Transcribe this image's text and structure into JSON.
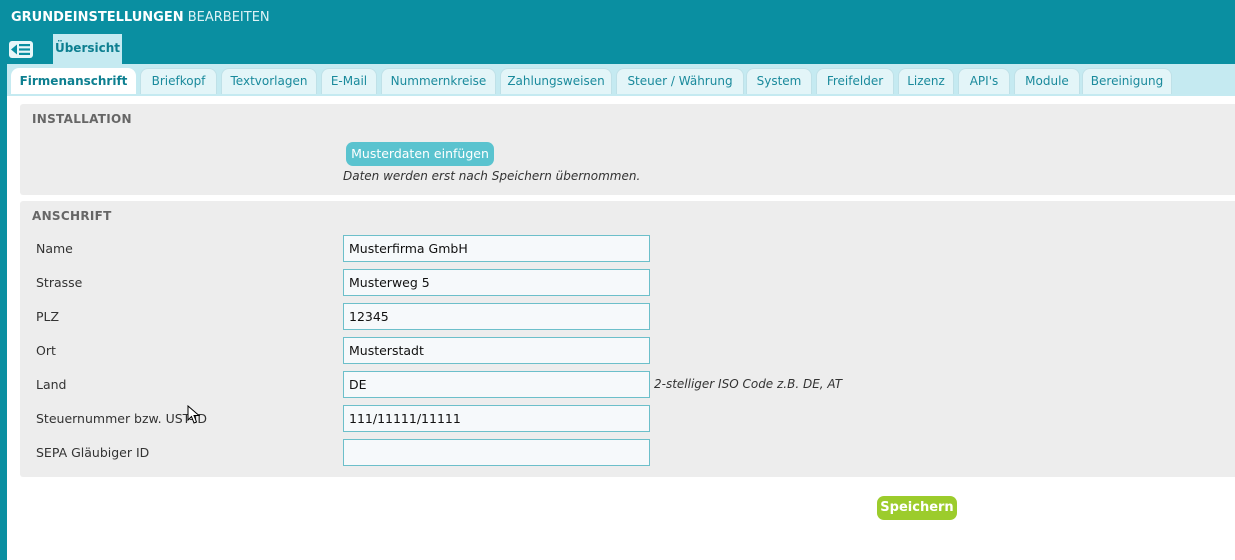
{
  "header": {
    "title_bold": "GRUNDEINSTELLUNGEN",
    "title_rest": "BEARBEITEN",
    "view_tab": "Übersicht"
  },
  "tabs": [
    {
      "label": "Firmenanschrift",
      "active": true
    },
    {
      "label": "Briefkopf"
    },
    {
      "label": "Textvorlagen"
    },
    {
      "label": "E-Mail"
    },
    {
      "label": "Nummernkreise"
    },
    {
      "label": "Zahlungsweisen"
    },
    {
      "label": "Steuer / Währung"
    },
    {
      "label": "System"
    },
    {
      "label": "Freifelder"
    },
    {
      "label": "Lizenz"
    },
    {
      "label": "API's"
    },
    {
      "label": "Module"
    },
    {
      "label": "Bereinigung"
    }
  ],
  "installation": {
    "title": "INSTALLATION",
    "button": "Musterdaten einfügen",
    "note": "Daten werden erst nach Speichern übernommen."
  },
  "address": {
    "title": "ANSCHRIFT",
    "fields": [
      {
        "label": "Name",
        "value": "Musterfirma GmbH"
      },
      {
        "label": "Strasse",
        "value": "Musterweg 5"
      },
      {
        "label": "PLZ",
        "value": "12345"
      },
      {
        "label": "Ort",
        "value": "Musterstadt"
      },
      {
        "label": "Land",
        "value": "DE",
        "hint": "2-stelliger ISO Code z.B. DE, AT"
      },
      {
        "label": "Steuernummer bzw. UST-ID",
        "value": "111/11111/11111"
      },
      {
        "label": "SEPA Gläubiger ID",
        "value": ""
      }
    ]
  },
  "save_label": "Speichern",
  "colors": {
    "header": "#0a8fa1",
    "tabbar": "#c5eaf1",
    "sample_button": "#5ac3cf",
    "save_button": "#9ccc2c",
    "field_border": "#6cbfca"
  }
}
